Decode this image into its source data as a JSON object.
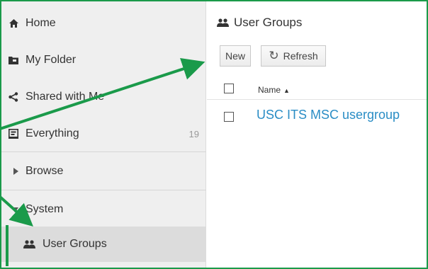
{
  "sidebar": {
    "items": [
      {
        "label": "Home",
        "icon": "home-icon"
      },
      {
        "label": "My Folder",
        "icon": "folder-icon"
      },
      {
        "label": "Shared with Me",
        "icon": "share-icon"
      },
      {
        "label": "Everything",
        "icon": "everything-icon",
        "count": "19"
      },
      {
        "label": "Browse",
        "icon": "caret-right-icon"
      },
      {
        "label": "System",
        "icon": "caret-down-icon"
      },
      {
        "label": "User Groups",
        "icon": "user-groups-icon"
      }
    ]
  },
  "main": {
    "title": "User Groups",
    "toolbar": {
      "new_label": "New",
      "refresh_label": "Refresh"
    },
    "table": {
      "header_name": "Name",
      "sort_indicator": "▲",
      "rows": [
        {
          "name": "USC ITS MSC usergroup"
        }
      ]
    }
  },
  "colors": {
    "annotation": "#1a9a4a",
    "link": "#2a8dc5",
    "sidebar_bg": "#efefef"
  }
}
